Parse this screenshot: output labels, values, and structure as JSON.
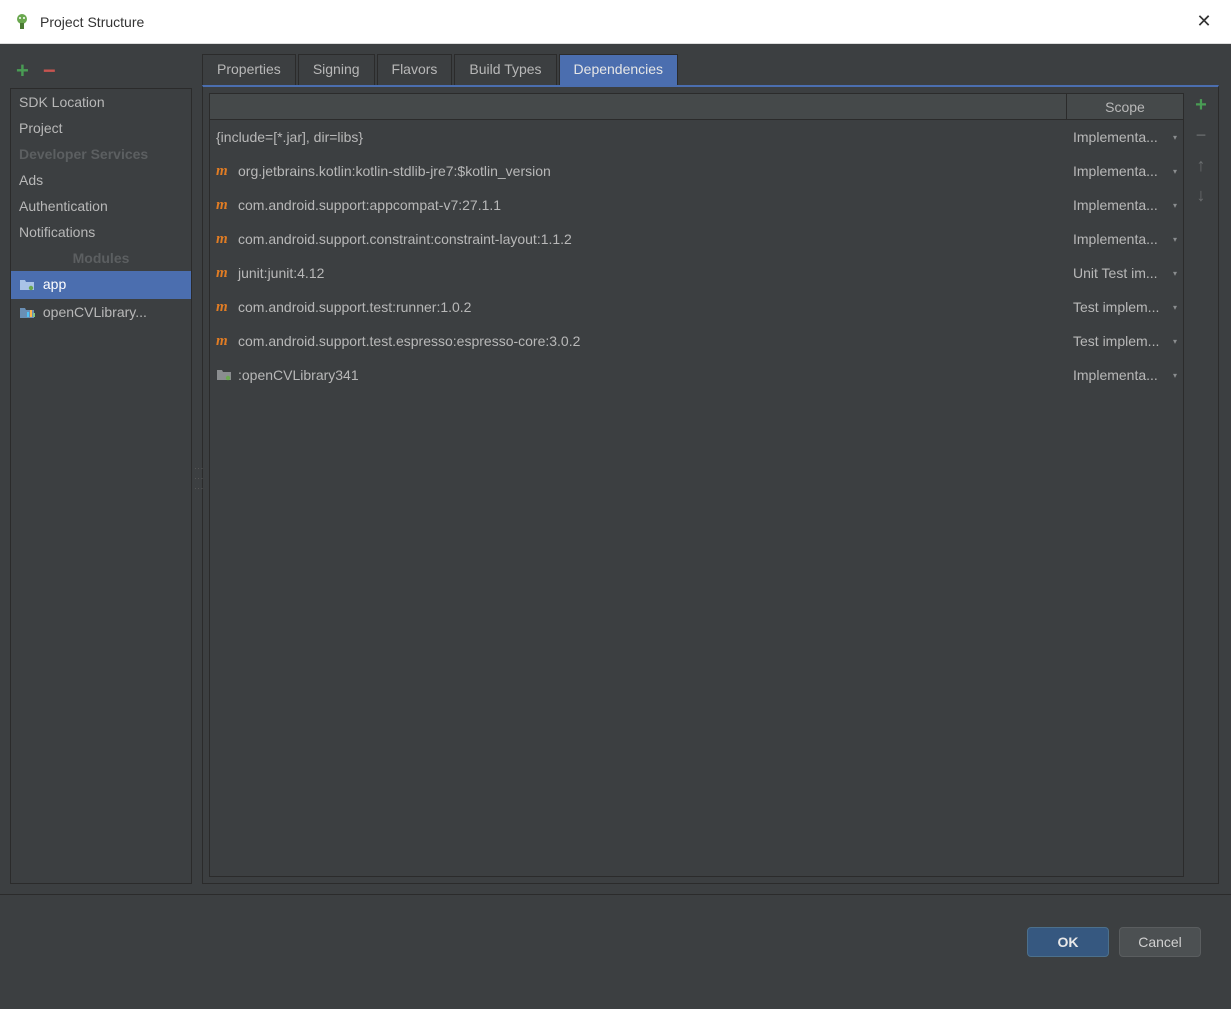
{
  "window": {
    "title": "Project Structure"
  },
  "sidebar": {
    "items": [
      {
        "label": "SDK Location",
        "type": "item"
      },
      {
        "label": "Project",
        "type": "item"
      },
      {
        "label": "Developer Services",
        "type": "section"
      },
      {
        "label": "Ads",
        "type": "item"
      },
      {
        "label": "Authentication",
        "type": "item"
      },
      {
        "label": "Notifications",
        "type": "item"
      },
      {
        "label": "Modules",
        "type": "section-center"
      },
      {
        "label": "app",
        "type": "module",
        "icon": "module-folder",
        "selected": true
      },
      {
        "label": "openCVLibrary...",
        "type": "module",
        "icon": "module-lib"
      }
    ]
  },
  "tabs": [
    {
      "label": "Properties"
    },
    {
      "label": "Signing"
    },
    {
      "label": "Flavors"
    },
    {
      "label": "Build Types"
    },
    {
      "label": "Dependencies",
      "active": true
    }
  ],
  "depHeader": {
    "scope": "Scope"
  },
  "dependencies": [
    {
      "icon": "none",
      "name": "{include=[*.jar], dir=libs}",
      "scope": "Implementa..."
    },
    {
      "icon": "m",
      "name": "org.jetbrains.kotlin:kotlin-stdlib-jre7:$kotlin_version",
      "scope": "Implementa..."
    },
    {
      "icon": "m",
      "name": "com.android.support:appcompat-v7:27.1.1",
      "scope": "Implementa..."
    },
    {
      "icon": "m",
      "name": "com.android.support.constraint:constraint-layout:1.1.2",
      "scope": "Implementa..."
    },
    {
      "icon": "m",
      "name": "junit:junit:4.12",
      "scope": "Unit Test im..."
    },
    {
      "icon": "m",
      "name": "com.android.support.test:runner:1.0.2",
      "scope": "Test implem..."
    },
    {
      "icon": "m",
      "name": "com.android.support.test.espresso:espresso-core:3.0.2",
      "scope": "Test implem..."
    },
    {
      "icon": "folder",
      "name": ":openCVLibrary341",
      "scope": "Implementa..."
    }
  ],
  "footer": {
    "ok": "OK",
    "cancel": "Cancel"
  }
}
